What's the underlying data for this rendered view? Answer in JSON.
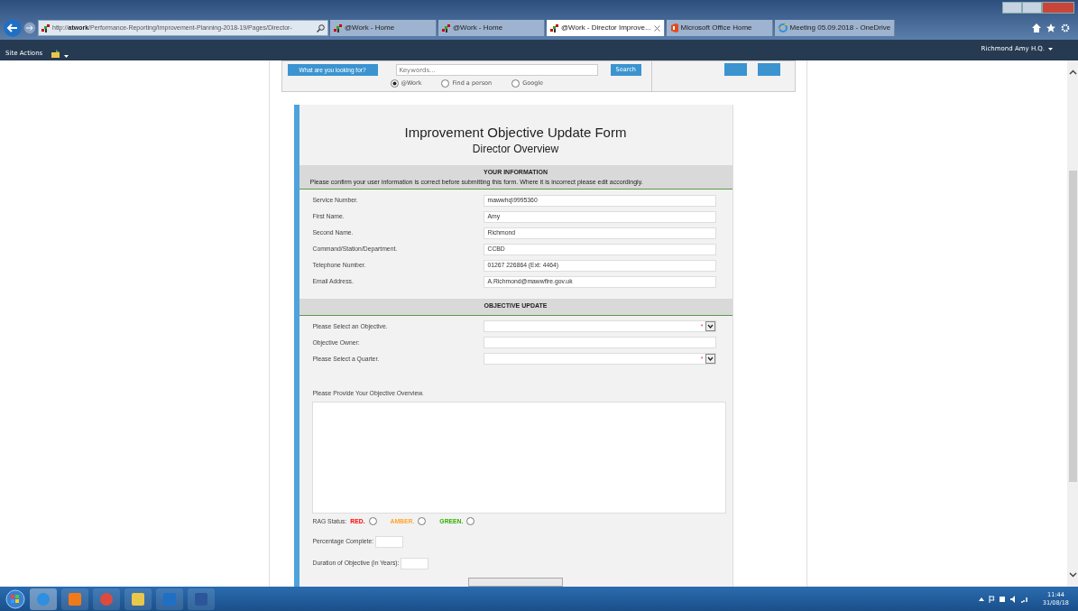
{
  "browser": {
    "address": {
      "prefix": "http://",
      "host": "atwork",
      "path": "/Performance-Reporting/Improvement-Planning-2018-19/Pages/Director-"
    },
    "tabs": [
      {
        "title": "@Work - Home",
        "selected": false,
        "kind": "atwork",
        "closable": false
      },
      {
        "title": "@Work - Home",
        "selected": false,
        "kind": "atwork",
        "closable": false
      },
      {
        "title": "@Work - Director Improve...",
        "selected": true,
        "kind": "atwork",
        "closable": true
      },
      {
        "title": "Microsoft Office Home",
        "selected": false,
        "kind": "office",
        "closable": false
      },
      {
        "title": "Meeting 05.09.2018 - OneDrive",
        "selected": false,
        "kind": "ie",
        "closable": false
      }
    ]
  },
  "site_bar": {
    "actions": "Site Actions",
    "user": "Richmond Amy H.Q."
  },
  "search": {
    "prompt": "What are you looking for?",
    "placeholder": "Keywords...",
    "submit": "Search",
    "scopes": [
      {
        "label": "@Work",
        "selected": true
      },
      {
        "label": "Find a person",
        "selected": false
      },
      {
        "label": "Google",
        "selected": false
      }
    ]
  },
  "form": {
    "title": "Improvement Objective Update Form",
    "subtitle": "Director Overview",
    "sections": [
      {
        "heading": "YOUR INFORMATION",
        "note": "Please confirm your user information is correct before submitting this form. Where it is incorrect please edit accordingly.",
        "fields": [
          {
            "label": "Service Number.",
            "kind": "text",
            "value": "mawwhq\\9995360"
          },
          {
            "label": "First Name.",
            "kind": "text",
            "value": "Amy"
          },
          {
            "label": "Second Name.",
            "kind": "text",
            "value": "Richmond"
          },
          {
            "label": "Command/Station/Department.",
            "kind": "text",
            "value": "CCBD"
          },
          {
            "label": "Telephone Number.",
            "kind": "text",
            "value": "01267 226864 (Ext: 4464)"
          },
          {
            "label": "Email Address.",
            "kind": "text",
            "value": "A.Richmond@mawwfire.gov.uk"
          }
        ]
      },
      {
        "heading": "OBJECTIVE UPDATE",
        "fields": [
          {
            "label": "Please Select an Objective.",
            "kind": "select",
            "required_mark": "*"
          },
          {
            "label": "Objective Owner:",
            "kind": "text"
          },
          {
            "label": "Please Select a Quarter.",
            "kind": "select",
            "required_mark": "*"
          }
        ]
      }
    ],
    "overview_label": "Please Provide Your Objective Overview.",
    "rag": {
      "label": "RAG Status:",
      "options": [
        {
          "label": "RED.",
          "color": "#ff0000",
          "selected": false
        },
        {
          "label": "AMBER.",
          "color": "#ffa530",
          "selected": false
        },
        {
          "label": "GREEN.",
          "color": "#33b000",
          "selected": false
        }
      ]
    },
    "percentage_label": "Percentage Complete:",
    "duration_label": "Duration of Objective (in Years):"
  },
  "taskbar": {
    "time": "11:44",
    "date": "31/08/18"
  }
}
